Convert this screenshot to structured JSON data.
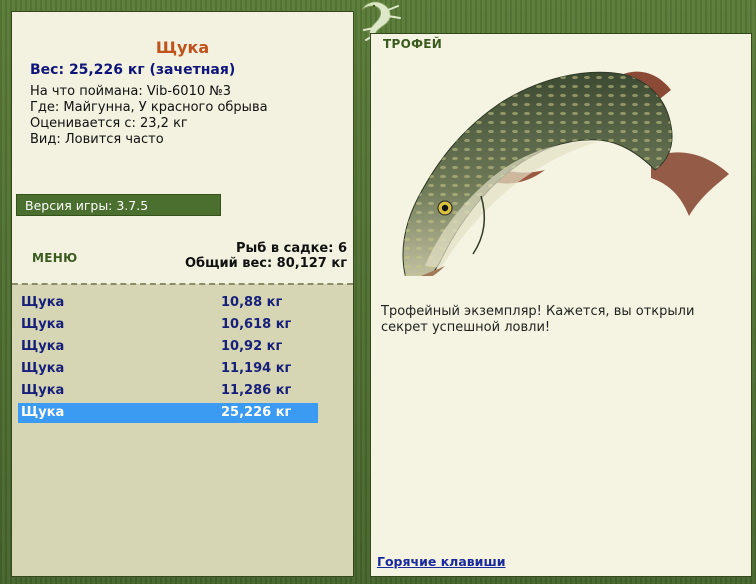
{
  "left": {
    "fish_name": "Щука",
    "weight_line": "Вес: 25,226 кг (зачетная)",
    "info_lines": [
      "На что поймана: Vib-6010 №3",
      "Где: Майгунна, У красного обрыва",
      "Оценивается с: 23,2 кг",
      "Вид: Ловится часто"
    ],
    "version": "Версия игры: 3.7.5",
    "menu_label": "МЕНЮ",
    "cage_count": "Рыб в садке: 6",
    "total_weight": "Общий вес: 80,127 кг",
    "catches": [
      {
        "name": "Щука",
        "weight": "10,88 кг"
      },
      {
        "name": "Щука",
        "weight": "10,618 кг"
      },
      {
        "name": "Щука",
        "weight": "10,92 кг"
      },
      {
        "name": "Щука",
        "weight": "11,194 кг"
      },
      {
        "name": "Щука",
        "weight": "11,286 кг"
      },
      {
        "name": "Щука",
        "weight": "25,226 кг",
        "selected": true
      }
    ]
  },
  "right": {
    "trophy_label": "ТРОФЕЙ",
    "trophy_text": "Трофейный экземпляр! Кажется, вы открыли секрет успешной ловли!",
    "hotkeys": "Горячие клавиши"
  },
  "icons": {
    "fish": "pike-fish-image",
    "logo": "lizard-icon"
  },
  "colors": {
    "frame": "#4d6b2e",
    "panel_light": "#f3f2e0",
    "list_bg": "#d7d6b4",
    "selected_row": "#3b9bf2",
    "title_orange": "#c0521c",
    "navy_text": "#10157a"
  }
}
